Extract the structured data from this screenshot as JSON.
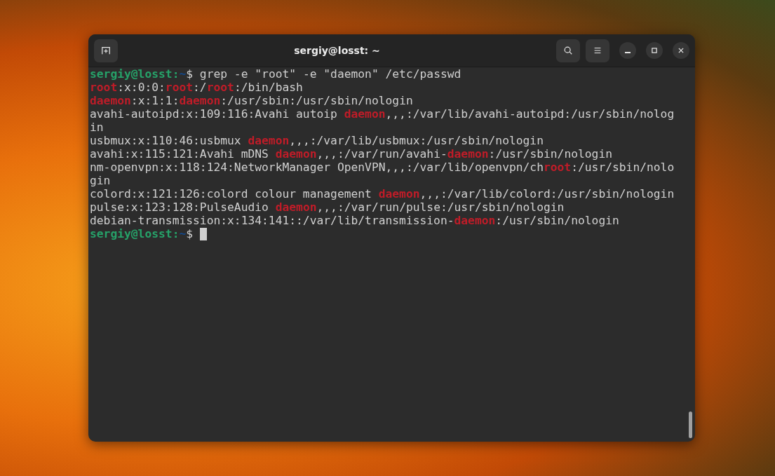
{
  "window": {
    "title": "sergiy@losst: ~"
  },
  "terminal": {
    "lines": [
      {
        "cursor": false,
        "segments": [
          {
            "kind": "user",
            "text": "sergiy@losst:"
          },
          {
            "kind": "path",
            "text": "~"
          },
          {
            "kind": "plain",
            "text": "$ grep -e \"root\" -e \"daemon\" /etc/passwd"
          }
        ]
      },
      {
        "cursor": false,
        "segments": [
          {
            "kind": "match",
            "text": "root"
          },
          {
            "kind": "plain",
            "text": ":x:0:0:"
          },
          {
            "kind": "match",
            "text": "root"
          },
          {
            "kind": "plain",
            "text": ":/"
          },
          {
            "kind": "match",
            "text": "root"
          },
          {
            "kind": "plain",
            "text": ":/bin/bash"
          }
        ]
      },
      {
        "cursor": false,
        "segments": [
          {
            "kind": "match",
            "text": "daemon"
          },
          {
            "kind": "plain",
            "text": ":x:1:1:"
          },
          {
            "kind": "match",
            "text": "daemon"
          },
          {
            "kind": "plain",
            "text": ":/usr/sbin:/usr/sbin/nologin"
          }
        ]
      },
      {
        "cursor": false,
        "segments": [
          {
            "kind": "plain",
            "text": "avahi-autoipd:x:109:116:Avahi autoip "
          },
          {
            "kind": "match",
            "text": "daemon"
          },
          {
            "kind": "plain",
            "text": ",,,:/var/lib/avahi-autoipd:/usr/sbin/nolog"
          }
        ]
      },
      {
        "cursor": false,
        "segments": [
          {
            "kind": "plain",
            "text": "in"
          }
        ]
      },
      {
        "cursor": false,
        "segments": [
          {
            "kind": "plain",
            "text": "usbmux:x:110:46:usbmux "
          },
          {
            "kind": "match",
            "text": "daemon"
          },
          {
            "kind": "plain",
            "text": ",,,:/var/lib/usbmux:/usr/sbin/nologin"
          }
        ]
      },
      {
        "cursor": false,
        "segments": [
          {
            "kind": "plain",
            "text": "avahi:x:115:121:Avahi mDNS "
          },
          {
            "kind": "match",
            "text": "daemon"
          },
          {
            "kind": "plain",
            "text": ",,,:/var/run/avahi-"
          },
          {
            "kind": "match",
            "text": "daemon"
          },
          {
            "kind": "plain",
            "text": ":/usr/sbin/nologin"
          }
        ]
      },
      {
        "cursor": false,
        "segments": [
          {
            "kind": "plain",
            "text": "nm-openvpn:x:118:124:NetworkManager OpenVPN,,,:/var/lib/openvpn/ch"
          },
          {
            "kind": "match",
            "text": "root"
          },
          {
            "kind": "plain",
            "text": ":/usr/sbin/nolo"
          }
        ]
      },
      {
        "cursor": false,
        "segments": [
          {
            "kind": "plain",
            "text": "gin"
          }
        ]
      },
      {
        "cursor": false,
        "segments": [
          {
            "kind": "plain",
            "text": "colord:x:121:126:colord colour management "
          },
          {
            "kind": "match",
            "text": "daemon"
          },
          {
            "kind": "plain",
            "text": ",,,:/var/lib/colord:/usr/sbin/nologin"
          }
        ]
      },
      {
        "cursor": false,
        "segments": [
          {
            "kind": "plain",
            "text": "pulse:x:123:128:PulseAudio "
          },
          {
            "kind": "match",
            "text": "daemon"
          },
          {
            "kind": "plain",
            "text": ",,,:/var/run/pulse:/usr/sbin/nologin"
          }
        ]
      },
      {
        "cursor": false,
        "segments": [
          {
            "kind": "plain",
            "text": "debian-transmission:x:134:141::/var/lib/transmission-"
          },
          {
            "kind": "match",
            "text": "daemon"
          },
          {
            "kind": "plain",
            "text": ":/usr/sbin/nologin"
          }
        ]
      },
      {
        "cursor": true,
        "segments": [
          {
            "kind": "user",
            "text": "sergiy@losst:"
          },
          {
            "kind": "path",
            "text": "~"
          },
          {
            "kind": "plain",
            "text": "$ "
          }
        ]
      }
    ]
  }
}
